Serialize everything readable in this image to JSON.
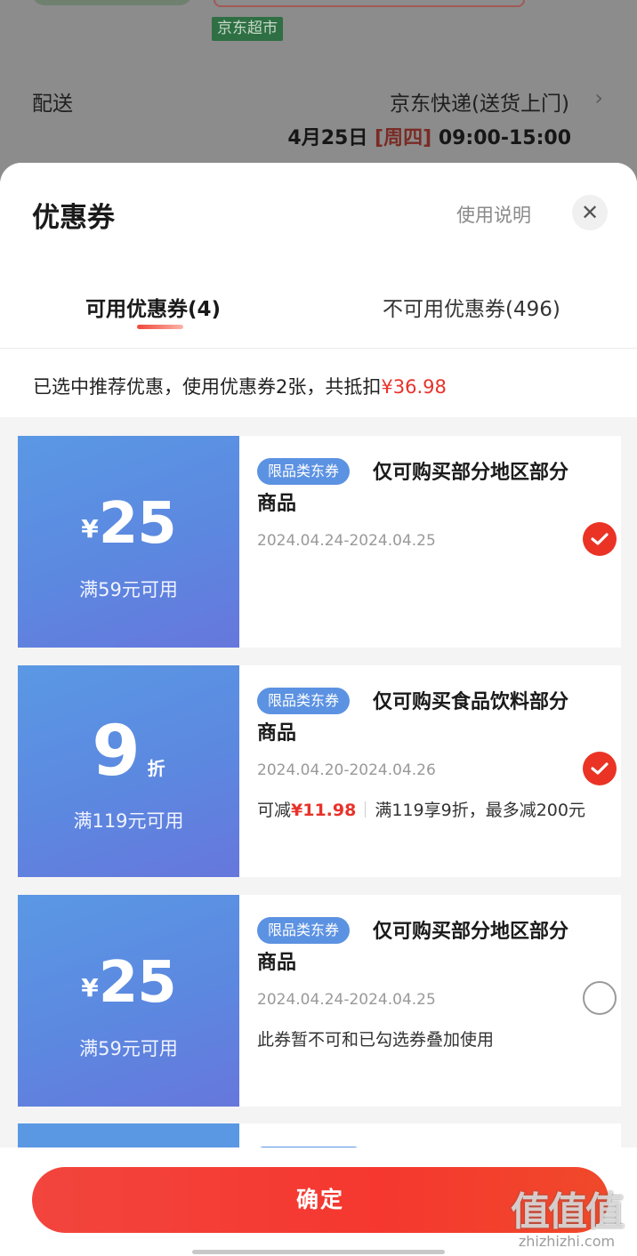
{
  "background": {
    "store_tag": "京东超市",
    "delivery_label": "配送",
    "delivery_method": "京东快递(送货上门)",
    "delivery_date": "4月25日",
    "delivery_weekday": "[周四]",
    "delivery_time": "09:00-15:00",
    "arrow": "›"
  },
  "sheet": {
    "title": "优惠券",
    "help_link": "使用说明",
    "close": "✕",
    "tabs": [
      {
        "label": "可用优惠券(4)",
        "active": true
      },
      {
        "label": "不可用优惠券(496)",
        "active": false
      }
    ],
    "summary_prefix": "已选中推荐优惠，使用优惠券2张，共抵扣",
    "summary_amount": "¥36.98"
  },
  "coupons": [
    {
      "currency": "¥",
      "amount": "25",
      "threshold": "满59元可用",
      "tag": "限品类东券",
      "title": "仅可购买部分地区部分商品",
      "date_range": "2024.04.24-2024.04.25",
      "selected": true
    },
    {
      "discount": "9",
      "discount_unit": "折",
      "threshold": "满119元可用",
      "tag": "限品类东券",
      "title": "仅可购买食品饮料部分商品",
      "date_range": "2024.04.20-2024.04.26",
      "savings_prefix": "可减",
      "savings_amount": "¥11.98",
      "savings_note": "满119享9折，最多减200元",
      "selected": true
    },
    {
      "currency": "¥",
      "amount": "25",
      "threshold": "满59元可用",
      "tag": "限品类东券",
      "title": "仅可购买部分地区部分商品",
      "date_range": "2024.04.24-2024.04.25",
      "note": "此券暂不可和已勾选券叠加使用",
      "selected": false
    }
  ],
  "footer": {
    "confirm": "确定"
  },
  "watermark": {
    "logo": "值值值",
    "url": "zhizhizhi.com"
  },
  "colors": {
    "accent_red": "#e8322a",
    "coupon_blue": "#5c88e0",
    "confirm_red": "#f2453d"
  }
}
